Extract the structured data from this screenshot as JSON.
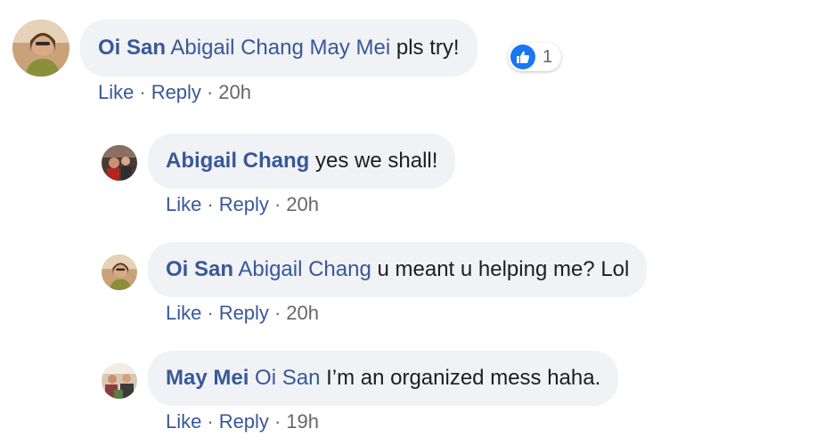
{
  "comments": [
    {
      "author": "Oi San",
      "mention": "Abigail Chang May Mei",
      "text": "pls try!",
      "avatar_icon": "profile-photo-oi-san",
      "reactions": {
        "icon": "like-thumbs-up-icon",
        "count": "1"
      },
      "like_label": "Like",
      "reply_label": "Reply",
      "time": "20h"
    },
    {
      "author": "Abigail Chang",
      "mention": "",
      "text": "yes we shall!",
      "avatar_icon": "profile-photo-abigail-chang",
      "like_label": "Like",
      "reply_label": "Reply",
      "time": "20h"
    },
    {
      "author": "Oi San",
      "mention": "Abigail Chang",
      "text": "u meant u helping me? Lol",
      "avatar_icon": "profile-photo-oi-san",
      "like_label": "Like",
      "reply_label": "Reply",
      "time": "20h"
    },
    {
      "author": "May Mei",
      "mention": "Oi San",
      "text": "I’m an organized mess haha.",
      "avatar_icon": "profile-photo-may-mei",
      "like_label": "Like",
      "reply_label": "Reply",
      "time": "19h"
    }
  ],
  "separator": "·",
  "colors": {
    "link": "#385898",
    "bubble": "#f0f2f5",
    "like_badge": "#1877f2",
    "meta": "#65676b"
  }
}
